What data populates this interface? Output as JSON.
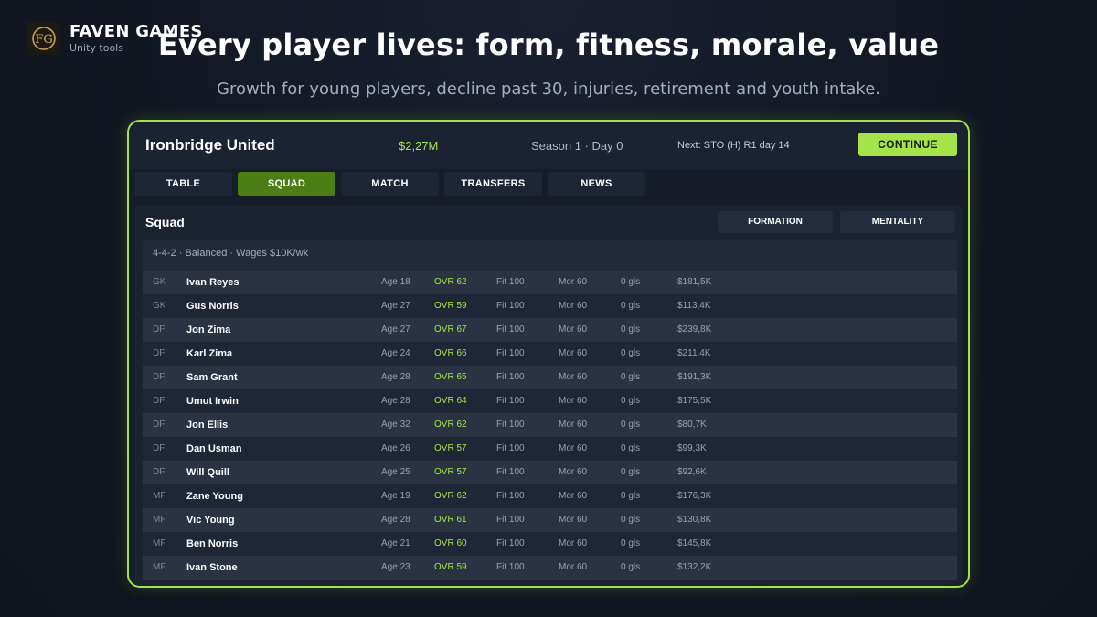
{
  "brand": {
    "name": "FAVEN GAMES",
    "tagline": "Unity tools",
    "logo_icon": "fg-monogram-icon"
  },
  "headline": "Every player lives: form, fitness, morale, value",
  "subheadline": "Growth for young players, decline past 30, injuries, retirement and youth intake.",
  "colors": {
    "accent": "#a5e34a",
    "active_tab": "#4c7e16",
    "background": "#121722"
  },
  "topbar": {
    "team_name": "Ironbridge United",
    "budget": "$2,27M",
    "season": "Season 1  ·  Day 0",
    "next_match": "Next: STO (H)  R1  day 14",
    "continue_label": "CONTINUE"
  },
  "tabs": [
    {
      "label": "TABLE",
      "active": false
    },
    {
      "label": "SQUAD",
      "active": true
    },
    {
      "label": "MATCH",
      "active": false
    },
    {
      "label": "TRANSFERS",
      "active": false
    },
    {
      "label": "NEWS",
      "active": false
    }
  ],
  "squad": {
    "title": "Squad",
    "formation_label": "FORMATION",
    "mentality_label": "MENTALITY",
    "info": "4-4-2  ·  Balanced  ·  Wages $10K/wk",
    "players": [
      {
        "pos": "GK",
        "name": "Ivan Reyes",
        "age": "Age 18",
        "ovr": "OVR 62",
        "fit": "Fit 100",
        "mor": "Mor 60",
        "gls": "0 gls",
        "value": "$181,5K"
      },
      {
        "pos": "GK",
        "name": "Gus Norris",
        "age": "Age 27",
        "ovr": "OVR 59",
        "fit": "Fit 100",
        "mor": "Mor 60",
        "gls": "0 gls",
        "value": "$113,4K"
      },
      {
        "pos": "DF",
        "name": "Jon Zima",
        "age": "Age 27",
        "ovr": "OVR 67",
        "fit": "Fit 100",
        "mor": "Mor 60",
        "gls": "0 gls",
        "value": "$239,8K"
      },
      {
        "pos": "DF",
        "name": "Karl Zima",
        "age": "Age 24",
        "ovr": "OVR 66",
        "fit": "Fit 100",
        "mor": "Mor 60",
        "gls": "0 gls",
        "value": "$211,4K"
      },
      {
        "pos": "DF",
        "name": "Sam Grant",
        "age": "Age 28",
        "ovr": "OVR 65",
        "fit": "Fit 100",
        "mor": "Mor 60",
        "gls": "0 gls",
        "value": "$191,3K"
      },
      {
        "pos": "DF",
        "name": "Umut Irwin",
        "age": "Age 28",
        "ovr": "OVR 64",
        "fit": "Fit 100",
        "mor": "Mor 60",
        "gls": "0 gls",
        "value": "$175,5K"
      },
      {
        "pos": "DF",
        "name": "Jon Ellis",
        "age": "Age 32",
        "ovr": "OVR 62",
        "fit": "Fit 100",
        "mor": "Mor 60",
        "gls": "0 gls",
        "value": "$80,7K"
      },
      {
        "pos": "DF",
        "name": "Dan Usman",
        "age": "Age 26",
        "ovr": "OVR 57",
        "fit": "Fit 100",
        "mor": "Mor 60",
        "gls": "0 gls",
        "value": "$99,3K"
      },
      {
        "pos": "DF",
        "name": "Will Quill",
        "age": "Age 25",
        "ovr": "OVR 57",
        "fit": "Fit 100",
        "mor": "Mor 60",
        "gls": "0 gls",
        "value": "$92,6K"
      },
      {
        "pos": "MF",
        "name": "Zane Young",
        "age": "Age 19",
        "ovr": "OVR 62",
        "fit": "Fit 100",
        "mor": "Mor 60",
        "gls": "0 gls",
        "value": "$176,3K"
      },
      {
        "pos": "MF",
        "name": "Vic Young",
        "age": "Age 28",
        "ovr": "OVR 61",
        "fit": "Fit 100",
        "mor": "Mor 60",
        "gls": "0 gls",
        "value": "$130,8K"
      },
      {
        "pos": "MF",
        "name": "Ben Norris",
        "age": "Age 21",
        "ovr": "OVR 60",
        "fit": "Fit 100",
        "mor": "Mor 60",
        "gls": "0 gls",
        "value": "$145,8K"
      },
      {
        "pos": "MF",
        "name": "Ivan Stone",
        "age": "Age 23",
        "ovr": "OVR 59",
        "fit": "Fit 100",
        "mor": "Mor 60",
        "gls": "0 gls",
        "value": "$132,2K"
      }
    ]
  }
}
